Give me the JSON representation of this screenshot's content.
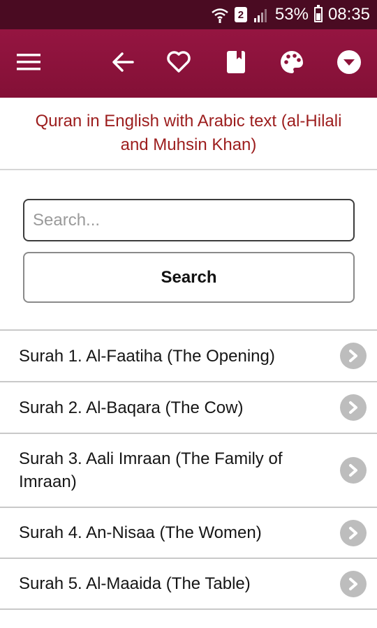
{
  "status_bar": {
    "sim_number": "2",
    "battery": "53%",
    "battery_level": 0.53,
    "time": "08:35"
  },
  "toolbar": {
    "icons": [
      "menu-icon",
      "back-arrow-icon",
      "heart-icon",
      "bookmark-icon",
      "palette-icon",
      "dropdown-circle-icon"
    ],
    "background_color": "#8d1239"
  },
  "page": {
    "title": "Quran in English with Arabic text (al-Hilali and Muhsin Khan)",
    "title_color": "#9c1d1d"
  },
  "search": {
    "placeholder": "Search...",
    "value": "",
    "button_label": "Search"
  },
  "surahs": [
    {
      "label": "Surah 1. Al-Faatiha (The Opening)"
    },
    {
      "label": "Surah 2. Al-Baqara (The Cow)"
    },
    {
      "label": "Surah 3. Aali Imraan (The Family of Imraan)"
    },
    {
      "label": "Surah 4. An-Nisaa (The Women)"
    },
    {
      "label": "Surah 5. Al-Maaida (The Table)"
    }
  ]
}
